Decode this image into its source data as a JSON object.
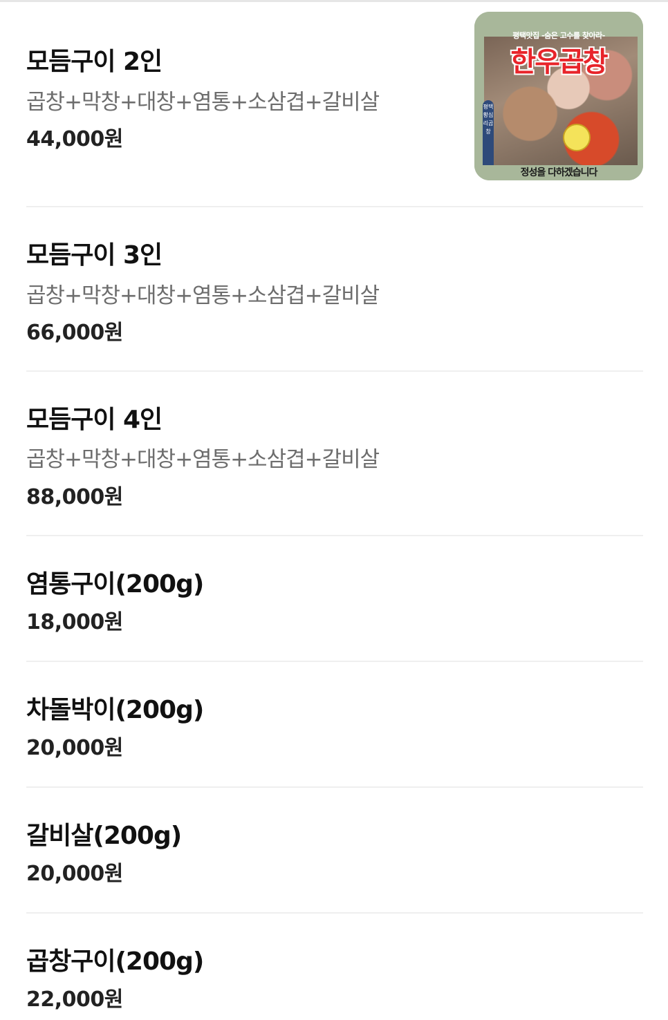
{
  "menu": {
    "items": [
      {
        "name": "모듬구이 2인",
        "desc": "곱창+막창+대창+염통+소삼겹+갈비살",
        "price": "44,000원",
        "thumbnail": {
          "top_caption": "평택맛집 -숨은 고수를 찾아라-",
          "title": "한우곱창",
          "side_tag": "평택 황심리곱창",
          "bottom_caption": "정성을 다하겠습니다"
        }
      },
      {
        "name": "모듬구이 3인",
        "desc": "곱창+막창+대창+염통+소삼겹+갈비살",
        "price": "66,000원"
      },
      {
        "name": "모듬구이 4인",
        "desc": "곱창+막창+대창+염통+소삼겹+갈비살",
        "price": "88,000원"
      },
      {
        "name": "염통구이(200g)",
        "price": "18,000원"
      },
      {
        "name": "차돌박이(200g)",
        "price": "20,000원"
      },
      {
        "name": "갈비살(200g)",
        "price": "20,000원"
      },
      {
        "name": "곱창구이(200g)",
        "price": "22,000원"
      }
    ]
  }
}
